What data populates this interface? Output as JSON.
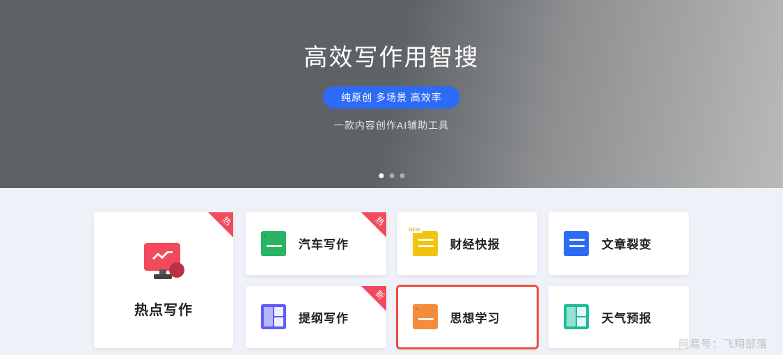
{
  "hero": {
    "title": "高效写作用智搜",
    "badge": "纯原创 多场景 高效率",
    "subtitle": "一款内容创作AI辅助工具"
  },
  "featured": {
    "title": "热点写作",
    "tag": "热",
    "icon": "chart-monitor-icon"
  },
  "cards": [
    {
      "title": "汽车写作",
      "tag": "热",
      "icon": "book-green-icon",
      "color": "#28b463"
    },
    {
      "title": "财经快报",
      "tag": null,
      "icon": "news-yellow-icon",
      "color": "#f1c40f",
      "hasNew": true
    },
    {
      "title": "文章裂变",
      "tag": null,
      "icon": "doc-blue-icon",
      "color": "#2d6bf7"
    },
    {
      "title": "提纲写作",
      "tag": "新",
      "icon": "grid-purple-icon",
      "color": "#5d5df7"
    },
    {
      "title": "思想学习",
      "tag": null,
      "icon": "book-orange-icon",
      "color": "#f58b3c",
      "highlighted": true
    },
    {
      "title": "天气预报",
      "tag": null,
      "icon": "panel-teal-icon",
      "color": "#1abc9c"
    }
  ],
  "watermark": "网易号：飞翔部落"
}
